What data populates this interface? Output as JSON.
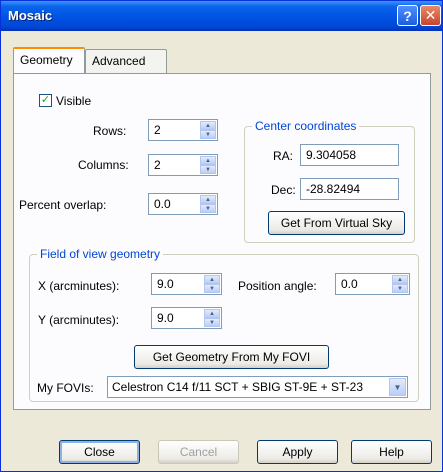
{
  "window": {
    "title": "Mosaic",
    "help_glyph": "?",
    "close_glyph": "✕"
  },
  "tabs": [
    {
      "label": "Geometry",
      "active": true
    },
    {
      "label": "Advanced",
      "active": false
    }
  ],
  "visible": {
    "label": "Visible",
    "checked": true,
    "glyph": "✓"
  },
  "rows": {
    "label": "Rows:",
    "value": "2"
  },
  "columns": {
    "label": "Columns:",
    "value": "2"
  },
  "overlap": {
    "label": "Percent overlap:",
    "value": "0.0"
  },
  "center": {
    "title": "Center coordinates",
    "ra_label": "RA:",
    "ra_value": "9.304058",
    "dec_label": "Dec:",
    "dec_value": "-28.82494",
    "get_button": "Get From Virtual Sky"
  },
  "fov": {
    "title": "Field of view geometry",
    "x_label": "X (arcminutes):",
    "x_value": "9.0",
    "y_label": "Y (arcminutes):",
    "y_value": "9.0",
    "angle_label": "Position angle:",
    "angle_value": "0.0",
    "get_button": "Get Geometry From My FOVI",
    "myfovis_label": "My FOVIs:",
    "myfovis_value": "Celestron C14 f/11 SCT + SBIG ST-9E + ST-23"
  },
  "footer": {
    "close": "Close",
    "cancel": "Cancel",
    "apply": "Apply",
    "help": "Help"
  },
  "icons": {
    "spin_up": "▲",
    "spin_down": "▼",
    "dropdown": "▼"
  }
}
